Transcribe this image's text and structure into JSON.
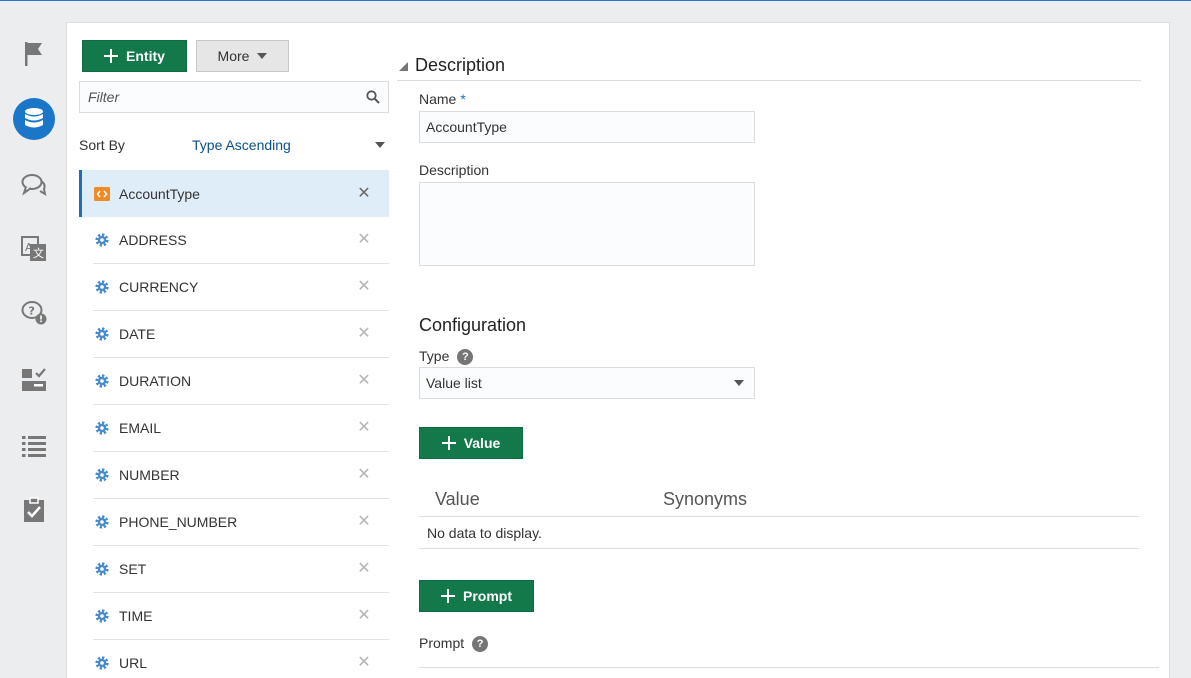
{
  "sidebar": {
    "items": [
      {
        "icon": "flag-icon"
      },
      {
        "icon": "database-icon",
        "active": true
      },
      {
        "icon": "chat-bubbles-icon"
      },
      {
        "icon": "translate-icon"
      },
      {
        "icon": "question-chat-icon"
      },
      {
        "icon": "components-icon"
      },
      {
        "icon": "list-icon"
      },
      {
        "icon": "clipboard-check-icon"
      }
    ],
    "active_color": "#1a76c9"
  },
  "toolbar": {
    "entity_label": "Entity",
    "more_label": "More"
  },
  "filter": {
    "placeholder": "Filter"
  },
  "sort": {
    "label": "Sort By",
    "value": "Type Ascending"
  },
  "entities": [
    {
      "name": "AccountType",
      "icon": "custom-entity-icon",
      "selected": true
    },
    {
      "name": "ADDRESS",
      "icon": "gear-icon"
    },
    {
      "name": "CURRENCY",
      "icon": "gear-icon"
    },
    {
      "name": "DATE",
      "icon": "gear-icon"
    },
    {
      "name": "DURATION",
      "icon": "gear-icon"
    },
    {
      "name": "EMAIL",
      "icon": "gear-icon"
    },
    {
      "name": "NUMBER",
      "icon": "gear-icon"
    },
    {
      "name": "PHONE_NUMBER",
      "icon": "gear-icon"
    },
    {
      "name": "SET",
      "icon": "gear-icon"
    },
    {
      "name": "TIME",
      "icon": "gear-icon"
    },
    {
      "name": "URL",
      "icon": "gear-icon"
    }
  ],
  "description_section": {
    "title": "Description",
    "name_label": "Name",
    "name_required": "*",
    "name_value": "AccountType",
    "description_label": "Description",
    "description_value": ""
  },
  "configuration": {
    "title": "Configuration",
    "type_label": "Type",
    "type_value": "Value list",
    "add_value_label": "Value",
    "table": {
      "columns": [
        "Value",
        "Synonyms"
      ],
      "empty_message": "No data to display."
    },
    "add_prompt_label": "Prompt",
    "prompt_label": "Prompt"
  },
  "colors": {
    "primary_button": "#13794b",
    "accent": "#1a76c9",
    "selected_row": "#deedf8",
    "entity_icon": "#f08a24",
    "gear_icon": "#4a8ccb"
  }
}
